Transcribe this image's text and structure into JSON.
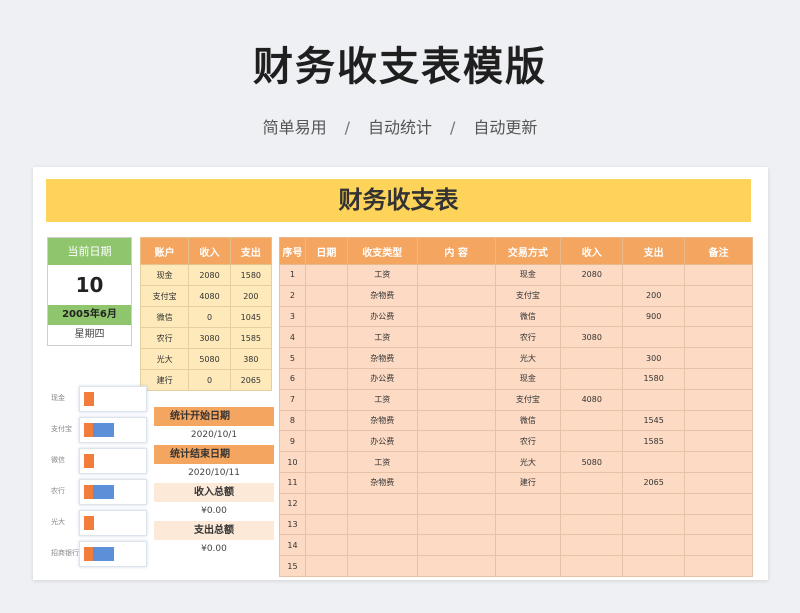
{
  "page": {
    "title": "财务收支表模版",
    "features": [
      "简单易用",
      "自动统计",
      "自动更新"
    ],
    "separator": "/"
  },
  "sheet": {
    "title": "财务收支表",
    "date_block": {
      "header": "当前日期",
      "day": "10",
      "year_month": "2005年6月",
      "weekday": "星期四"
    },
    "accounts": {
      "headers": [
        "账户",
        "收入",
        "支出"
      ],
      "rows": [
        [
          "现金",
          "2080",
          "1580"
        ],
        [
          "支付宝",
          "4080",
          "200"
        ],
        [
          "微信",
          "0",
          "1045"
        ],
        [
          "农行",
          "3080",
          "1585"
        ],
        [
          "光大",
          "5080",
          "380"
        ],
        [
          "建行",
          "0",
          "2065"
        ]
      ]
    },
    "summary": {
      "start_label": "统计开始日期",
      "start_value": "2020/10/1",
      "end_label": "统计结束日期",
      "end_value": "2020/10/11",
      "income_label": "收入总额",
      "income_value": "¥0.00",
      "expense_label": "支出总额",
      "expense_value": "¥0.00"
    },
    "thumb_labels": [
      "现金",
      "支付宝",
      "微信",
      "农行",
      "光大",
      "招商银行"
    ],
    "ledger": {
      "headers": [
        "序号",
        "日期",
        "收支类型",
        "内 容",
        "交易方式",
        "收入",
        "支出",
        "备注"
      ],
      "rows": [
        [
          "1",
          "",
          "工资",
          "",
          "现金",
          "2080",
          "",
          ""
        ],
        [
          "2",
          "",
          "杂物费",
          "",
          "支付宝",
          "",
          "200",
          ""
        ],
        [
          "3",
          "",
          "办公费",
          "",
          "微信",
          "",
          "900",
          ""
        ],
        [
          "4",
          "",
          "工资",
          "",
          "农行",
          "3080",
          "",
          ""
        ],
        [
          "5",
          "",
          "杂物费",
          "",
          "光大",
          "",
          "300",
          ""
        ],
        [
          "6",
          "",
          "办公费",
          "",
          "现金",
          "",
          "1580",
          ""
        ],
        [
          "7",
          "",
          "工资",
          "",
          "支付宝",
          "4080",
          "",
          ""
        ],
        [
          "8",
          "",
          "杂物费",
          "",
          "微信",
          "",
          "1545",
          ""
        ],
        [
          "9",
          "",
          "办公费",
          "",
          "农行",
          "",
          "1585",
          ""
        ],
        [
          "10",
          "",
          "工资",
          "",
          "光大",
          "5080",
          "",
          ""
        ],
        [
          "11",
          "",
          "杂物费",
          "",
          "建行",
          "",
          "2065",
          ""
        ],
        [
          "12",
          "",
          "",
          "",
          "",
          "",
          "",
          ""
        ],
        [
          "13",
          "",
          "",
          "",
          "",
          "",
          "",
          ""
        ],
        [
          "14",
          "",
          "",
          "",
          "",
          "",
          "",
          ""
        ],
        [
          "15",
          "",
          "",
          "",
          "",
          "",
          "",
          ""
        ]
      ]
    }
  }
}
